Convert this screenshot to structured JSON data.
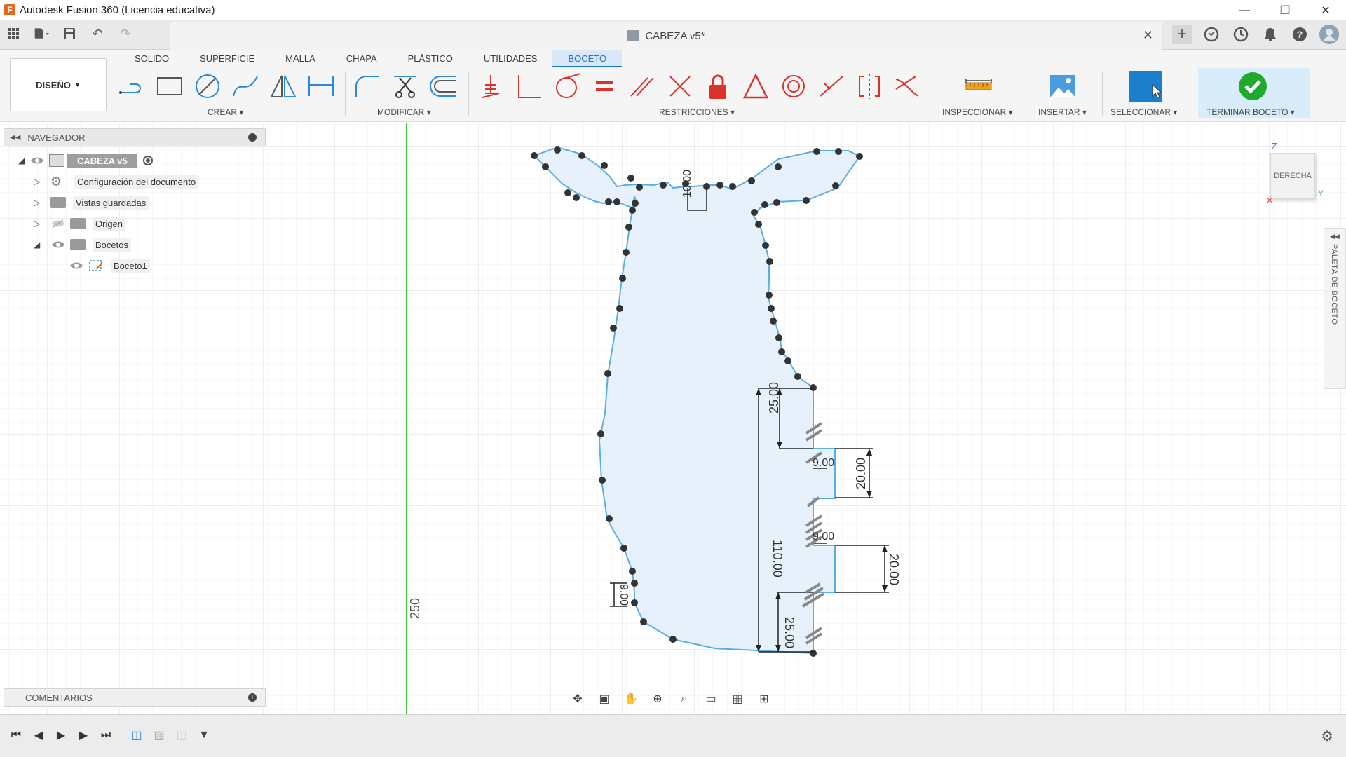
{
  "window": {
    "title": "Autodesk Fusion 360 (Licencia educativa)"
  },
  "document": {
    "name": "CABEZA v5*"
  },
  "ribbon": {
    "workspace": "DISEÑO",
    "tabs": [
      "SOLIDO",
      "SUPERFICIE",
      "MALLA",
      "CHAPA",
      "PLÁSTICO",
      "UTILIDADES",
      "BOCETO"
    ],
    "active_tab": "BOCETO",
    "groups": {
      "crear": "CREAR",
      "modificar": "MODIFICAR",
      "restricciones": "RESTRICCIONES",
      "inspeccionar": "INSPECCIONAR",
      "insertar": "INSERTAR",
      "seleccionar": "SELECCIONAR",
      "terminar": "TERMINAR BOCETO"
    }
  },
  "browser": {
    "title": "NAVEGADOR",
    "root": "CABEZA v5",
    "items": [
      {
        "label": "Configuración del documento"
      },
      {
        "label": "Vistas guardadas"
      },
      {
        "label": "Origen"
      },
      {
        "label": "Bocetos"
      },
      {
        "label": "Boceto1"
      }
    ]
  },
  "comments": {
    "label": "COMENTARIOS"
  },
  "viewcube": {
    "face": "DERECHA",
    "axes": {
      "z": "Z",
      "y": "Y"
    }
  },
  "sketch_palette": {
    "label": "PALETA DE BOCETO"
  },
  "dimensions": {
    "d1": "10.00",
    "d2": "25.00",
    "d3": "9.00",
    "d4": "20.00",
    "d5": "110.00",
    "d6": "9.00",
    "d7": "20.00",
    "d8": "9.00",
    "d9": "25.00",
    "d10": "250"
  },
  "colors": {
    "accent": "#1976d2",
    "sketch_line": "#5aaee6",
    "sketch_fill": "#e6f1fb",
    "axis_green": "#3cc83c",
    "finish_green": "#1faa2e"
  }
}
